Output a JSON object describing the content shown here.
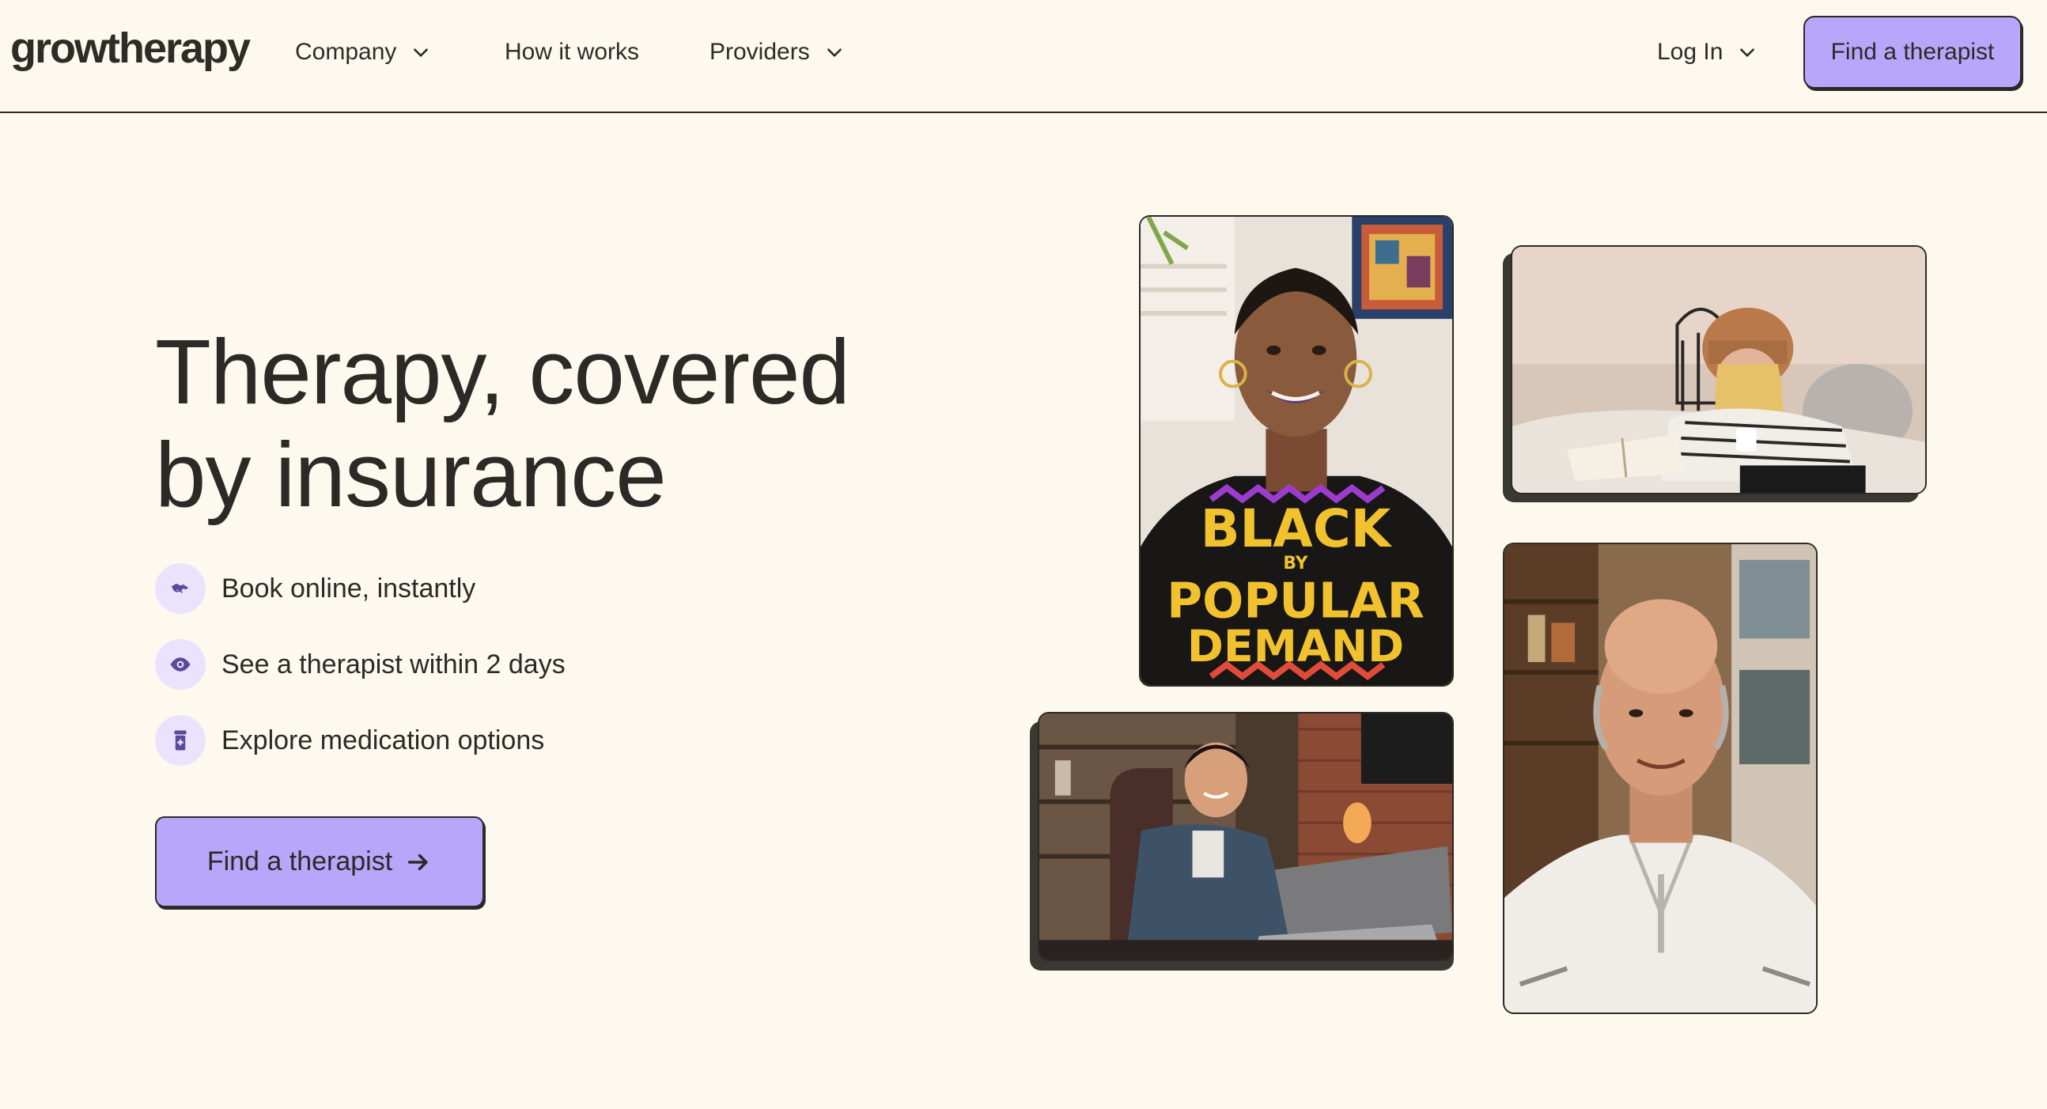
{
  "brand": {
    "logo_text": "growtherapy",
    "accent": "#b8a6fb",
    "background": "#fef9ee",
    "ink": "#2b2a26"
  },
  "nav": {
    "company": "Company",
    "how_it_works": "How it works",
    "providers": "Providers",
    "login": "Log In",
    "cta": "Find a therapist"
  },
  "hero": {
    "headline_line1": "Therapy, covered",
    "headline_line2": "by insurance",
    "features": [
      {
        "icon": "hands-icon",
        "label": "Book online, instantly"
      },
      {
        "icon": "eye-icon",
        "label": "See a therapist within 2 days"
      },
      {
        "icon": "pill-bottle-icon",
        "label": "Explore medication options"
      }
    ],
    "cta": "Find a therapist"
  },
  "photos": {
    "woman_shirt_line1": "BLACK",
    "woman_shirt_line2": "BY",
    "woman_shirt_line3": "POPULAR",
    "woman_shirt_line4": "DEMAND"
  }
}
